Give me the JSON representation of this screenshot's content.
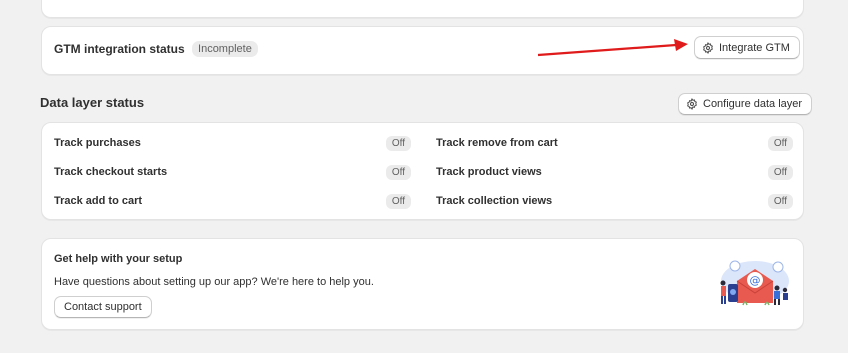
{
  "gtm": {
    "title": "GTM integration status",
    "status_badge": "Incomplete",
    "integrate_button": "Integrate GTM"
  },
  "data_layer": {
    "title": "Data layer status",
    "configure_button": "Configure data layer",
    "left_items": [
      {
        "label": "Track purchases",
        "status": "Off"
      },
      {
        "label": "Track checkout starts",
        "status": "Off"
      },
      {
        "label": "Track add to cart",
        "status": "Off"
      }
    ],
    "right_items": [
      {
        "label": "Track remove from cart",
        "status": "Off"
      },
      {
        "label": "Track product views",
        "status": "Off"
      },
      {
        "label": "Track collection views",
        "status": "Off"
      }
    ]
  },
  "help": {
    "title": "Get help with your setup",
    "text": "Have questions about setting up our app? We're here to help you.",
    "contact_button": "Contact support"
  },
  "colors": {
    "background": "#f1f1f1",
    "card": "#ffffff",
    "badge": "#ebebeb",
    "arrow": "#e01b1b"
  },
  "icons": {
    "gear": "gear-icon",
    "illustration": "email-support-illustration"
  }
}
